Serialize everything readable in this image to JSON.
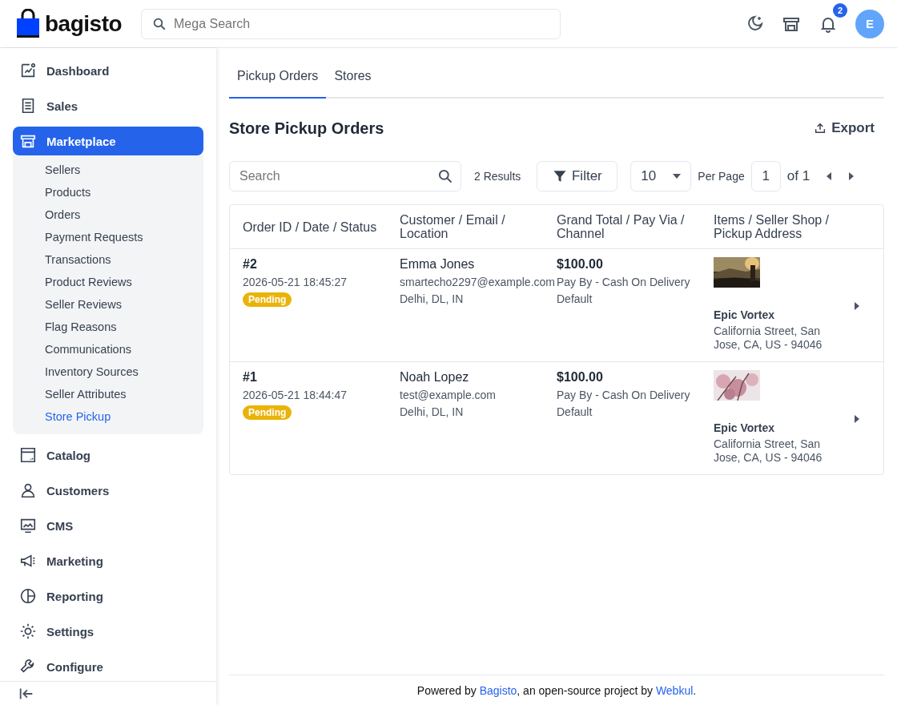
{
  "header": {
    "logo": "bagisto",
    "search": {
      "placeholder": "Mega Search"
    },
    "notifications": "2",
    "avatar": "E"
  },
  "sidebar": {
    "items": [
      {
        "label": "Dashboard",
        "selected": false
      },
      {
        "label": "Sales",
        "selected": false
      },
      {
        "label": "Marketplace",
        "selected": true,
        "expanded": true,
        "children": [
          {
            "label": "Sellers",
            "selected": false
          },
          {
            "label": "Products",
            "selected": false
          },
          {
            "label": "Orders",
            "selected": false
          },
          {
            "label": "Payment Requests",
            "selected": false
          },
          {
            "label": "Transactions",
            "selected": false
          },
          {
            "label": "Product Reviews",
            "selected": false
          },
          {
            "label": "Seller Reviews",
            "selected": false
          },
          {
            "label": "Flag Reasons",
            "selected": false
          },
          {
            "label": "Communications",
            "selected": false
          },
          {
            "label": "Inventory Sources",
            "selected": false
          },
          {
            "label": "Seller Attributes",
            "selected": false
          },
          {
            "label": "Store Pickup",
            "selected": true
          }
        ]
      },
      {
        "label": "Catalog",
        "selected": false
      },
      {
        "label": "Customers",
        "selected": false
      },
      {
        "label": "CMS",
        "selected": false
      },
      {
        "label": "Marketing",
        "selected": false
      },
      {
        "label": "Reporting",
        "selected": false
      },
      {
        "label": "Settings",
        "selected": false
      },
      {
        "label": "Configure",
        "selected": false
      }
    ]
  },
  "tabs": [
    {
      "label": "Pickup Orders",
      "selected": true
    },
    {
      "label": "Stores",
      "selected": false
    }
  ],
  "page": {
    "title": "Store Pickup Orders",
    "export": "Export"
  },
  "toolbar": {
    "search": {
      "placeholder": "Search"
    },
    "results": "2 Results",
    "filter": "Filter",
    "per_page_value": "10",
    "per_page_label": "Per Page",
    "page": "1",
    "of": "of 1"
  },
  "table": {
    "columns": [
      "Order ID / Date / Status",
      "Customer / Email / Location",
      "Grand Total / Pay Via / Channel",
      "Items / Seller Shop / Pickup Address"
    ],
    "rows": [
      {
        "order_id": "#2",
        "date": "2026-05-21 18:45:27",
        "status": "Pending",
        "customer": "Emma Jones",
        "email": "smartecho2297@example.com",
        "location": "Delhi, DL, IN",
        "total": "$100.00",
        "pay_via": "Pay By - Cash On Delivery",
        "channel": "Default",
        "shop": "Epic Vortex",
        "address": "California Street, San Jose, CA, US - 94046"
      },
      {
        "order_id": "#1",
        "date": "2026-05-21 18:44:47",
        "status": "Pending",
        "customer": "Noah Lopez",
        "email": "test@example.com",
        "location": "Delhi, DL, IN",
        "total": "$100.00",
        "pay_via": "Pay By - Cash On Delivery",
        "channel": "Default",
        "shop": "Epic Vortex",
        "address": "California Street, San Jose, CA, US - 94046"
      }
    ]
  },
  "footer": [
    {
      "kind": "text",
      "text": "Powered by "
    },
    {
      "kind": "link",
      "text": "Bagisto"
    },
    {
      "kind": "text",
      "text": ", an open-source project by "
    },
    {
      "kind": "link",
      "text": "Webkul"
    },
    {
      "kind": "text",
      "text": "."
    }
  ]
}
